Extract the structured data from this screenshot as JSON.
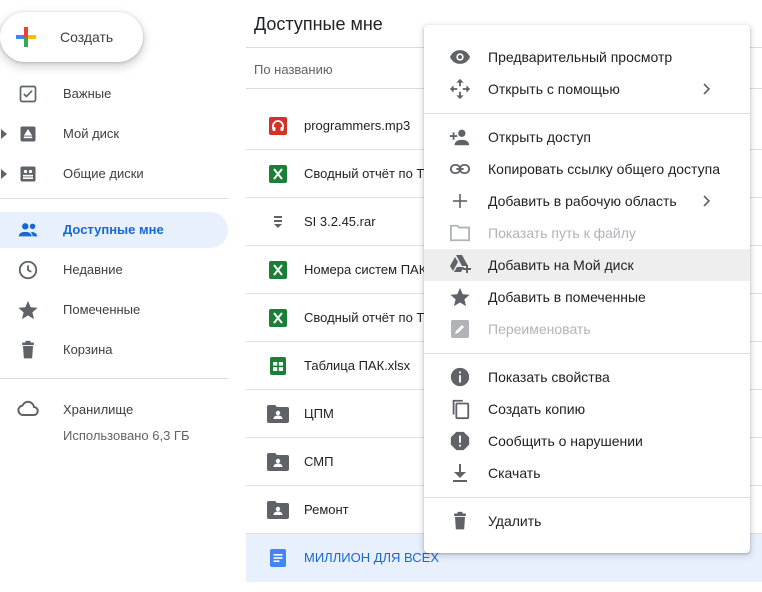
{
  "sidebar": {
    "create_label": "Создать",
    "items": [
      {
        "label": "Важные"
      },
      {
        "label": "Мой диск"
      },
      {
        "label": "Общие диски"
      },
      {
        "label": "Доступные мне"
      },
      {
        "label": "Недавние"
      },
      {
        "label": "Помеченные"
      },
      {
        "label": "Корзина"
      }
    ],
    "storage_label": "Хранилище",
    "storage_used": "Использовано 6,3 ГБ"
  },
  "main": {
    "title": "Доступные мне",
    "sort_column": "По названию",
    "files": [
      {
        "name": "programmers.mp3",
        "icon": "audio-icon"
      },
      {
        "name": "Сводный отчёт по ТП",
        "icon": "spreadsheet-icon"
      },
      {
        "name": "SI 3.2.45.rar",
        "icon": "archive-icon"
      },
      {
        "name": "Номера систем ПАК",
        "icon": "spreadsheet-icon"
      },
      {
        "name": "Сводный отчёт по ТП",
        "icon": "spreadsheet-icon"
      },
      {
        "name": "Таблица ПАК.xlsx",
        "icon": "sheets-icon"
      },
      {
        "name": "ЦПМ",
        "icon": "shared-folder-icon"
      },
      {
        "name": "СМП",
        "icon": "shared-folder-icon"
      },
      {
        "name": "Ремонт",
        "icon": "shared-folder-icon"
      },
      {
        "name": "МИЛЛИОН ДЛЯ ВСЕХ",
        "icon": "docs-icon"
      }
    ]
  },
  "context_menu": {
    "items": [
      {
        "label": "Предварительный просмотр",
        "icon": "eye-icon"
      },
      {
        "label": "Открыть с помощью",
        "icon": "move-icon"
      },
      {
        "label": "Открыть доступ",
        "icon": "person-add-icon"
      },
      {
        "label": "Копировать ссылку общего доступа",
        "icon": "link-icon"
      },
      {
        "label": "Добавить в рабочую область",
        "icon": "plus-icon"
      },
      {
        "label": "Показать путь к файлу",
        "icon": "folder-icon"
      },
      {
        "label": "Добавить на Мой диск",
        "icon": "drive-add-icon"
      },
      {
        "label": "Добавить в помеченные",
        "icon": "star-icon"
      },
      {
        "label": "Переименовать",
        "icon": "edit-icon"
      },
      {
        "label": "Показать свойства",
        "icon": "info-icon"
      },
      {
        "label": "Создать копию",
        "icon": "copy-icon"
      },
      {
        "label": "Сообщить о нарушении",
        "icon": "report-icon"
      },
      {
        "label": "Скачать",
        "icon": "download-icon"
      },
      {
        "label": "Удалить",
        "icon": "trash-icon"
      }
    ]
  },
  "colors": {
    "accent": "#1967d2",
    "active_bg": "#e8f0fe",
    "icon_gray": "#5f6368",
    "sheets_green": "#188038",
    "audio_red": "#d93025",
    "docs_blue": "#4285f4"
  }
}
